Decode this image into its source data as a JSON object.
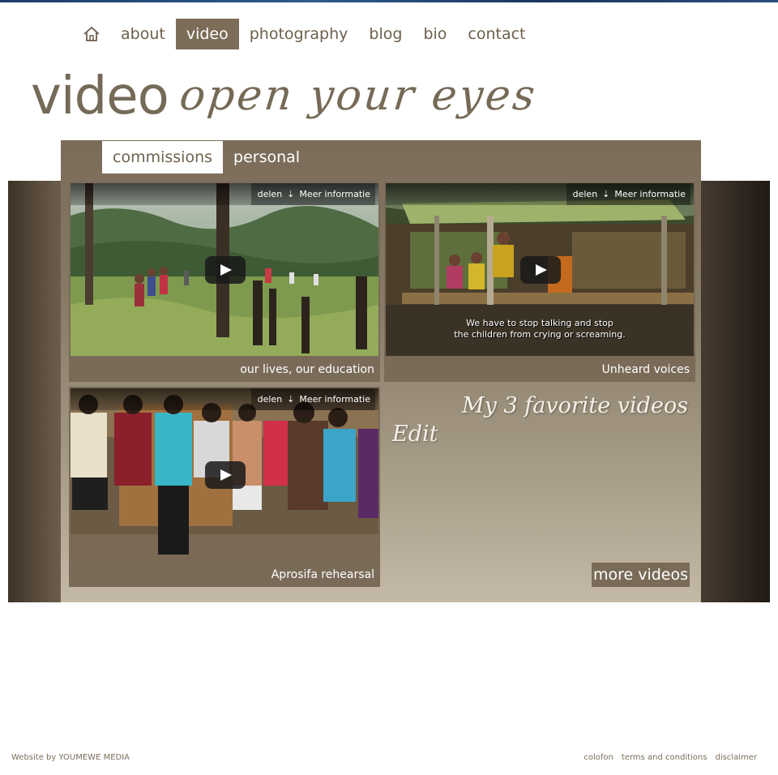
{
  "nav": {
    "items": [
      {
        "label": "about"
      },
      {
        "label": "video"
      },
      {
        "label": "photography"
      },
      {
        "label": "blog"
      },
      {
        "label": "bio"
      },
      {
        "label": "contact"
      }
    ],
    "active": "video"
  },
  "page": {
    "heading": "video",
    "tagline": "open your eyes"
  },
  "tabs": [
    {
      "label": "commissions"
    },
    {
      "label": "personal"
    }
  ],
  "videos": [
    {
      "title": "our lives, our education",
      "share_label": "delen",
      "info_label": "Meer informatie"
    },
    {
      "title": "Unheard voices",
      "share_label": "delen",
      "info_label": "Meer informatie",
      "subtitle_line1": "We have to stop talking and stop",
      "subtitle_line2": "the children from crying or screaming."
    },
    {
      "title": "Aprosifa rehearsal",
      "share_label": "delen",
      "info_label": "Meer informatie"
    }
  ],
  "favorites": {
    "title": "My 3 favorite videos",
    "edit_label": "Edit",
    "more_label": "more videos"
  },
  "footer": {
    "credit": "Website by YOUMEWE MEDIA",
    "links": [
      {
        "label": "colofon"
      },
      {
        "label": "terms and conditions"
      },
      {
        "label": "disclaimer"
      }
    ]
  },
  "colors": {
    "accent": "#7c6d58",
    "text": "#6d5f4b"
  }
}
